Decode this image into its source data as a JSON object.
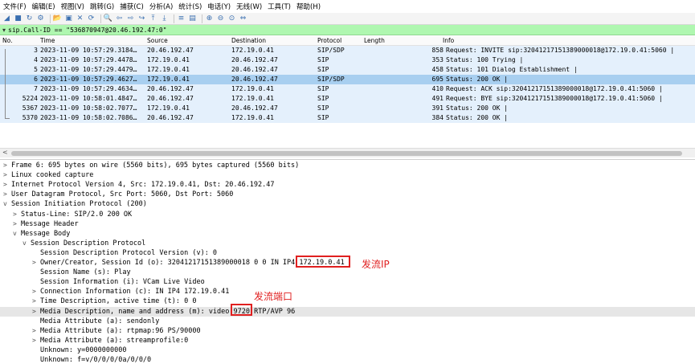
{
  "menu": [
    "文件(F)",
    "编辑(E)",
    "视图(V)",
    "跳转(G)",
    "捕获(C)",
    "分析(A)",
    "统计(S)",
    "电话(Y)",
    "无线(W)",
    "工具(T)",
    "帮助(H)"
  ],
  "toolbar_icons": [
    "shark-fin-icon",
    "stop-icon",
    "restart-icon",
    "options-icon",
    "open-icon",
    "save-icon",
    "close-file-icon",
    "reload-icon",
    "find-icon",
    "back-icon",
    "forward-icon",
    "go-to-icon",
    "first-icon",
    "last-icon",
    "autoscroll-icon",
    "colorize-icon",
    "zoom-in-icon",
    "zoom-out-icon",
    "normal-size-icon",
    "resize-columns-icon"
  ],
  "filter": {
    "value": "sip.Call-ID == \"536870947@20.46.192.47:0\""
  },
  "columns": [
    "No.",
    "Time",
    "Source",
    "Destination",
    "Protocol",
    "Length",
    "Info"
  ],
  "packets": [
    {
      "no": "3",
      "time": "2023-11-09 10:57:29.3184…",
      "src": "20.46.192.47",
      "dst": "172.19.0.41",
      "proto": "SIP/SDP",
      "len": "858",
      "info": "Request: INVITE sip:32041217151389000018@172.19.0.41:5060 |"
    },
    {
      "no": "4",
      "time": "2023-11-09 10:57:29.4478…",
      "src": "172.19.0.41",
      "dst": "20.46.192.47",
      "proto": "SIP",
      "len": "353",
      "info": "Status: 100 Trying |"
    },
    {
      "no": "5",
      "time": "2023-11-09 10:57:29.4479…",
      "src": "172.19.0.41",
      "dst": "20.46.192.47",
      "proto": "SIP",
      "len": "458",
      "info": "Status: 101 Dialog Establishment |"
    },
    {
      "no": "6",
      "time": "2023-11-09 10:57:29.4627…",
      "src": "172.19.0.41",
      "dst": "20.46.192.47",
      "proto": "SIP/SDP",
      "len": "695",
      "info": "Status: 200 OK |"
    },
    {
      "no": "7",
      "time": "2023-11-09 10:57:29.4634…",
      "src": "20.46.192.47",
      "dst": "172.19.0.41",
      "proto": "SIP",
      "len": "410",
      "info": "Request: ACK sip:32041217151389000018@172.19.0.41:5060 |"
    },
    {
      "no": "5224",
      "time": "2023-11-09 10:58:01.4847…",
      "src": "20.46.192.47",
      "dst": "172.19.0.41",
      "proto": "SIP",
      "len": "491",
      "info": "Request: BYE sip:32041217151389000018@172.19.0.41:5060 |"
    },
    {
      "no": "5367",
      "time": "2023-11-09 10:58:02.7077…",
      "src": "172.19.0.41",
      "dst": "20.46.192.47",
      "proto": "SIP",
      "len": "391",
      "info": "Status: 200 OK |"
    },
    {
      "no": "5370",
      "time": "2023-11-09 10:58:02.7086…",
      "src": "20.46.192.47",
      "dst": "172.19.0.41",
      "proto": "SIP",
      "len": "384",
      "info": "Status: 200 OK |"
    }
  ],
  "selected_row": 3,
  "details": [
    {
      "indent": 0,
      "tw": ">",
      "text": "Frame 6: 695 bytes on wire (5560 bits), 695 bytes captured (5560 bits)"
    },
    {
      "indent": 0,
      "tw": ">",
      "text": "Linux cooked capture"
    },
    {
      "indent": 0,
      "tw": ">",
      "text": "Internet Protocol Version 4, Src: 172.19.0.41, Dst: 20.46.192.47"
    },
    {
      "indent": 0,
      "tw": ">",
      "text": "User Datagram Protocol, Src Port: 5060, Dst Port: 5060"
    },
    {
      "indent": 0,
      "tw": "v",
      "text": "Session Initiation Protocol (200)"
    },
    {
      "indent": 1,
      "tw": ">",
      "text": "Status-Line: SIP/2.0 200 OK"
    },
    {
      "indent": 1,
      "tw": ">",
      "text": "Message Header"
    },
    {
      "indent": 1,
      "tw": "v",
      "text": "Message Body"
    },
    {
      "indent": 2,
      "tw": "v",
      "text": "Session Description Protocol"
    },
    {
      "indent": 3,
      "tw": "",
      "text": "Session Description Protocol Version (v): 0"
    },
    {
      "indent": 3,
      "tw": ">",
      "text": "Owner/Creator, Session Id (o): 32041217151389000018 0 0 IN IP4 172.19.0.41"
    },
    {
      "indent": 3,
      "tw": "",
      "text": "Session Name (s): Play"
    },
    {
      "indent": 3,
      "tw": "",
      "text": "Session Information (i): VCam Live Video"
    },
    {
      "indent": 3,
      "tw": ">",
      "text": "Connection Information (c): IN IP4 172.19.0.41"
    },
    {
      "indent": 3,
      "tw": ">",
      "text": "Time Description, active time (t): 0 0"
    },
    {
      "indent": 3,
      "tw": ">",
      "text": "Media Description, name and address (m): video 9720 RTP/AVP 96"
    },
    {
      "indent": 3,
      "tw": "",
      "text": "Media Attribute (a): sendonly"
    },
    {
      "indent": 3,
      "tw": ">",
      "text": "Media Attribute (a): rtpmap:96 PS/90000"
    },
    {
      "indent": 3,
      "tw": ">",
      "text": "Media Attribute (a): streamprofile:0"
    },
    {
      "indent": 3,
      "tw": "",
      "text": "Unknown: y=0000000000"
    },
    {
      "indent": 3,
      "tw": "",
      "text": "Unknown: f=v/0/0/0/0a/0/0/0"
    }
  ],
  "highlighted_detail": 15,
  "annotations": {
    "sender_ip": "发流IP",
    "sender_port": "发流端口"
  },
  "colors": {
    "filter_bg": "#aff7b0",
    "row_bg": "#e4f0fc",
    "row_selected_bg": "#a8cff0",
    "annotation_red": "#e02020"
  }
}
